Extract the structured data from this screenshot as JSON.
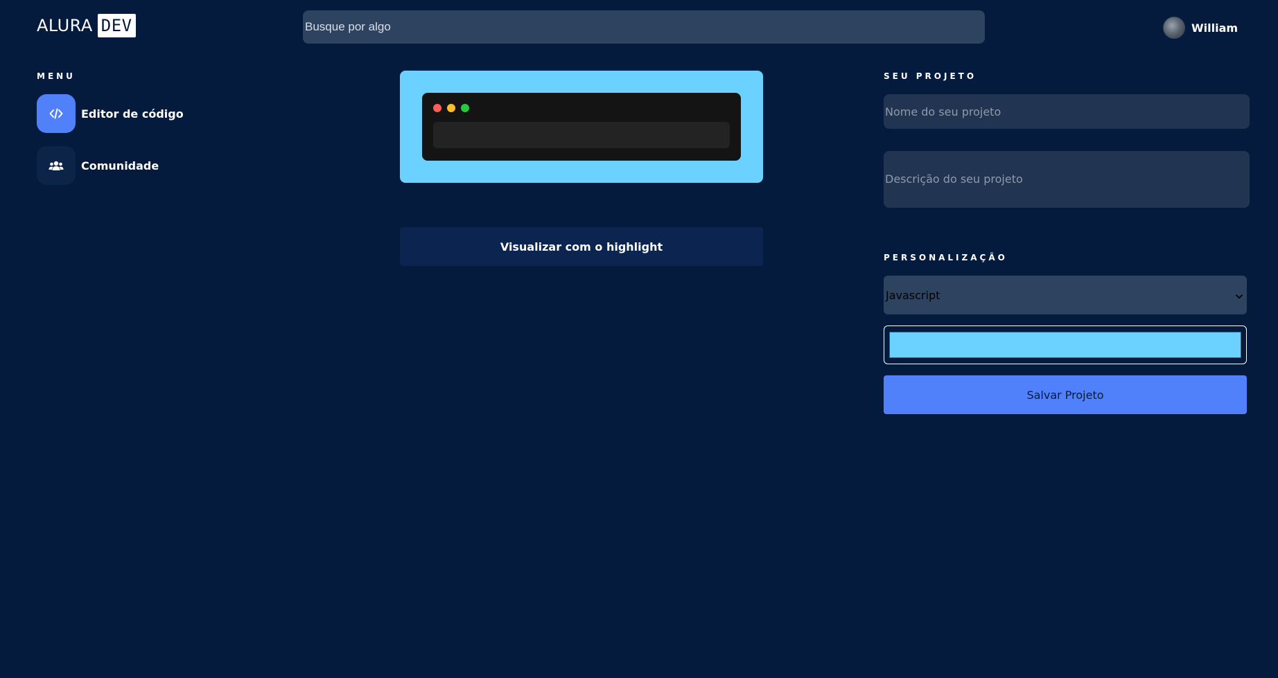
{
  "header": {
    "logo_text": "ALURA",
    "logo_badge": "DEV",
    "search": {
      "placeholder": "Busque por algo",
      "value": ""
    },
    "user": {
      "name": "William"
    }
  },
  "sidebar": {
    "title": "MENU",
    "items": [
      {
        "label": "Editor de código",
        "icon": "code-icon",
        "active": true
      },
      {
        "label": "Comunidade",
        "icon": "users-icon",
        "active": false
      }
    ]
  },
  "editor": {
    "border_color": "#6bd1ff",
    "window_dots": [
      "#ff5f56",
      "#ffbd2e",
      "#27c93f"
    ],
    "highlight_button": "Visualizar com o highlight"
  },
  "project": {
    "title": "SEU PROJETO",
    "name_placeholder": "Nome do seu projeto",
    "description_placeholder": "Descrição do seu projeto"
  },
  "customization": {
    "title": "PERSONALIZAÇÃO",
    "language_selected": "Javascript",
    "color_value": "#6bd1ff",
    "save_button": "Salvar Projeto"
  },
  "colors": {
    "background": "#051b3d",
    "accent": "#5081fb",
    "highlight": "#6bd1ff"
  }
}
